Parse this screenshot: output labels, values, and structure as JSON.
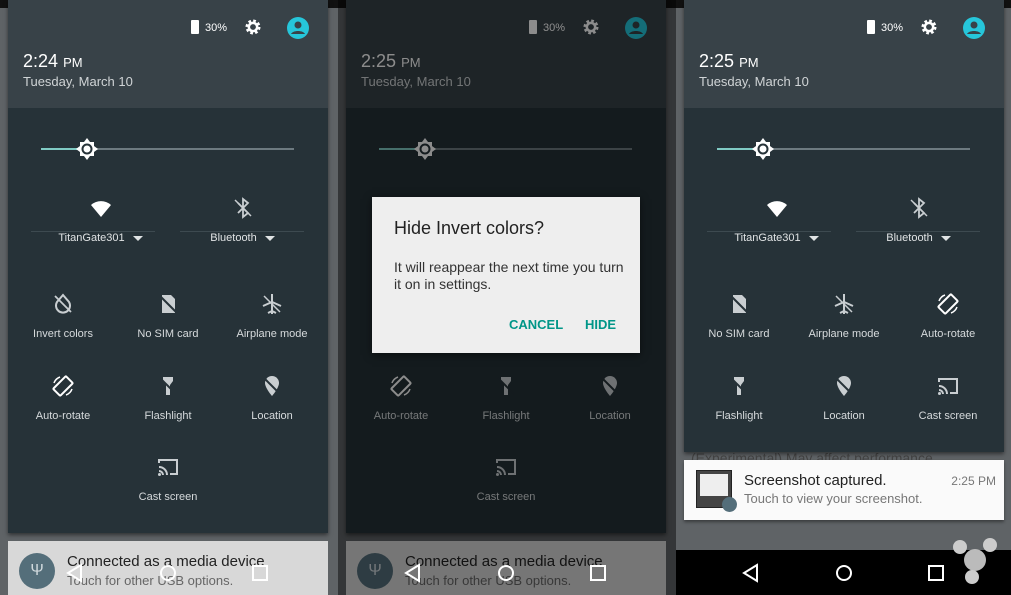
{
  "screens": [
    {
      "time": "2:24",
      "ampm": "PM",
      "date": "Tuesday, March 10",
      "battery": "30%",
      "brightness": 0.18,
      "wifi_label": "TitanGate301",
      "bt_label": "Bluetooth",
      "tiles": [
        {
          "icon": "invert-colors-icon",
          "label": "Invert colors"
        },
        {
          "icon": "no-sim-icon",
          "label": "No SIM card"
        },
        {
          "icon": "airplane-icon",
          "label": "Airplane mode"
        },
        {
          "icon": "auto-rotate-icon",
          "label": "Auto-rotate",
          "active": true
        },
        {
          "icon": "flashlight-icon",
          "label": "Flashlight"
        },
        {
          "icon": "location-icon",
          "label": "Location"
        },
        {
          "icon": "cast-icon",
          "label": "Cast screen"
        }
      ],
      "notification": {
        "title": "Connected as a media device",
        "subtitle": "Touch for other USB options."
      }
    },
    {
      "time": "2:25",
      "ampm": "PM",
      "date": "Tuesday, March 10",
      "battery": "30%",
      "brightness": 0.18,
      "wifi_label": "",
      "bt_label": "",
      "tiles": [
        {
          "icon": "auto-rotate-icon",
          "label": "Auto-rotate",
          "active": true
        },
        {
          "icon": "flashlight-icon",
          "label": "Flashlight"
        },
        {
          "icon": "location-icon",
          "label": "Location"
        },
        {
          "icon": "cast-icon",
          "label": "Cast screen"
        }
      ],
      "notification": {
        "title": "Connected as a media device",
        "subtitle": "Touch for other USB options."
      },
      "dialog": {
        "title": "Hide Invert colors?",
        "body": "It will reappear the next time you turn it on in settings.",
        "cancel": "CANCEL",
        "confirm": "HIDE"
      }
    },
    {
      "time": "2:25",
      "ampm": "PM",
      "date": "Tuesday, March 10",
      "battery": "30%",
      "brightness": 0.18,
      "wifi_label": "TitanGate301",
      "bt_label": "Bluetooth",
      "tiles": [
        {
          "icon": "no-sim-icon",
          "label": "No SIM card"
        },
        {
          "icon": "airplane-icon",
          "label": "Airplane mode"
        },
        {
          "icon": "auto-rotate-icon",
          "label": "Auto-rotate",
          "active": true
        },
        {
          "icon": "flashlight-icon",
          "label": "Flashlight"
        },
        {
          "icon": "location-icon",
          "label": "Location"
        },
        {
          "icon": "cast-icon",
          "label": "Cast screen"
        }
      ],
      "behind_text": "(Experimental) May affect performance",
      "screenshot_notification": {
        "title": "Screenshot captured.",
        "subtitle": "Touch to view your screenshot.",
        "time": "2:25 PM"
      }
    }
  ],
  "colors": {
    "accent": "#80cbc4",
    "avatar": "#26c6da",
    "button": "#009688",
    "panel": "#263238",
    "header": "#384248"
  }
}
